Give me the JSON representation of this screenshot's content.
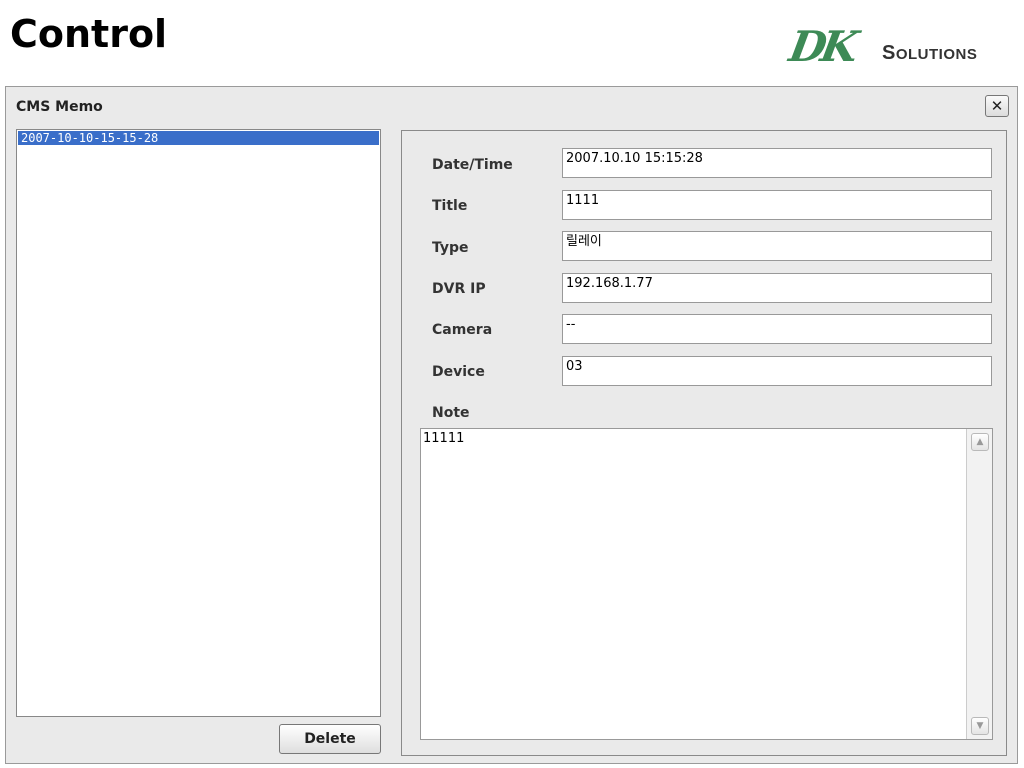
{
  "slide": {
    "title": "Control"
  },
  "logo": {
    "brand": "DK",
    "name_first": "S",
    "name_rest": "OLUTIONS"
  },
  "window": {
    "title": "CMS Memo",
    "close_symbol": "✕"
  },
  "memo_list": {
    "items": [
      "2007-10-10-15-15-28"
    ],
    "selected_index": 0
  },
  "buttons": {
    "delete_label": "Delete"
  },
  "detail": {
    "fields": [
      {
        "label": "Date/Time",
        "value": "2007.10.10  15:15:28"
      },
      {
        "label": "Title",
        "value": "1111"
      },
      {
        "label": "Type",
        "value": "릴레이"
      },
      {
        "label": "DVR IP",
        "value": "192.168.1.77"
      },
      {
        "label": "Camera",
        "value": "--"
      },
      {
        "label": "Device",
        "value": "03"
      }
    ],
    "note_label": "Note",
    "note_value": "11111"
  },
  "icons": {
    "close": "close-icon",
    "scroll_up": "scroll-up-arrow-icon",
    "scroll_down": "scroll-down-arrow-icon"
  },
  "colors": {
    "selection": "#3a6ec9",
    "logo_green": "#3d8a56",
    "window_bg": "#eaeaea"
  }
}
